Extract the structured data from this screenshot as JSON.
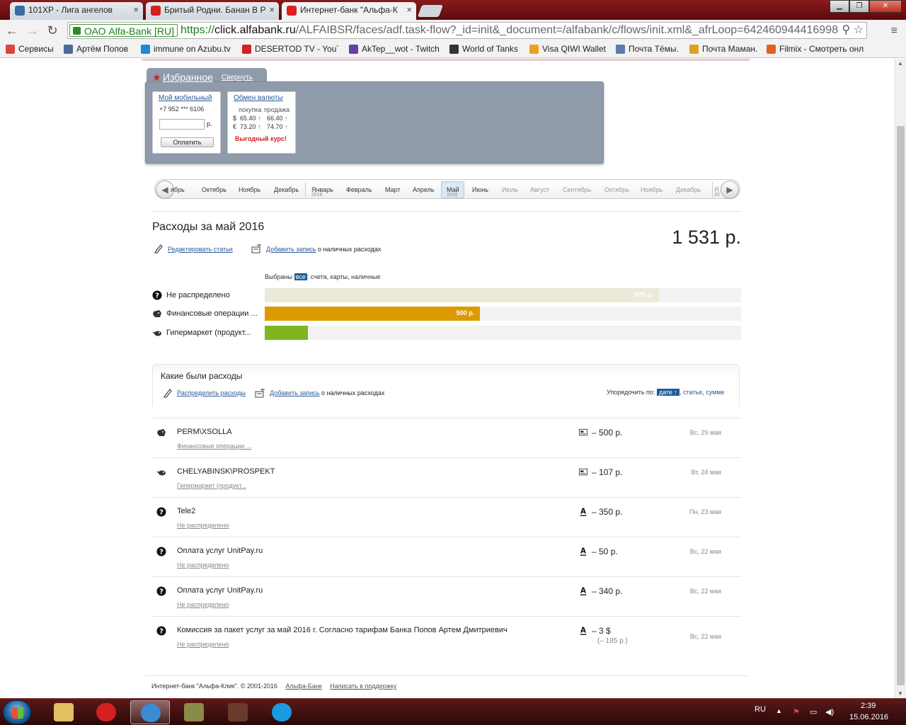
{
  "browser": {
    "tabs": [
      {
        "title": "101XP - Лига ангелов",
        "icon_color": "#3a6aa0"
      },
      {
        "title": "Бритый Родни. Банан В Р",
        "icon_color": "#d42020"
      },
      {
        "title": "Интернет-банк \"Альфа-К",
        "icon_color": "#e02020"
      }
    ],
    "close_glyph": "×",
    "window_buttons": {
      "minimize": "▁",
      "maximize": "❐",
      "close": "✕"
    },
    "nav": {
      "back": "←",
      "forward": "→",
      "reload": "↻"
    },
    "ev_badge": "ОАО Alfa-Bank [RU]",
    "url_scheme": "https://",
    "url_host": "click.alfabank.ru",
    "url_rest": "/ALFAIBSR/faces/adf.task-flow?_id=init&_document=/alfabank/c/flows/init.xml&_afrLoop=642460944416998008",
    "omni_icons": "⚲ ☆",
    "menu_glyph": "≡",
    "bookmarks": [
      {
        "label": "Сервисы",
        "icon_color": "#d44"
      },
      {
        "label": "Артём Попов",
        "icon_color": "#4a6a9a"
      },
      {
        "label": "immune on Azubu.tv",
        "icon_color": "#1a8ad4"
      },
      {
        "label": "DESERTOD TV - YouTu",
        "icon_color": "#d42020"
      },
      {
        "label": "AkTep__wot - Twitch",
        "icon_color": "#6441a4"
      },
      {
        "label": "World of Tanks",
        "icon_color": "#333"
      },
      {
        "label": "Visa QIWI Wallet",
        "icon_color": "#f0a020"
      },
      {
        "label": "Почта Тёмы.",
        "icon_color": "#5a7ab0"
      },
      {
        "label": "Почта Маман.",
        "icon_color": "#e0a020"
      },
      {
        "label": "Filmix - Смотреть онл",
        "icon_color": "#e06020"
      }
    ]
  },
  "favorites": {
    "title": "Избранное",
    "collapse": "Свернуть",
    "mobile": {
      "title": "Мой мобильный",
      "phone": "+7 952 *** 6106",
      "currency": "р.",
      "pay_button": "Оплатить"
    },
    "exchange": {
      "title": "Обмен валюты",
      "col_buy": "покупка",
      "col_sell": "продажа",
      "rates": [
        {
          "symbol": "$",
          "buy": "65.40",
          "sell": "66.40"
        },
        {
          "symbol": "€",
          "buy": "73.20",
          "sell": "74.70"
        }
      ],
      "up_arrow": "↑",
      "good_rate": "Выгодный курс!"
    }
  },
  "months": {
    "prev": "◀",
    "next": "▶",
    "items": [
      {
        "label": "ябрь",
        "year": "",
        "future": false
      },
      {
        "label": "Октябрь",
        "year": "",
        "future": false
      },
      {
        "label": "Ноябрь",
        "year": "",
        "future": false
      },
      {
        "label": "Декабрь",
        "year": "",
        "future": false
      },
      {
        "label": "Январь",
        "year": "2016",
        "future": false
      },
      {
        "label": "Февраль",
        "year": "",
        "future": false
      },
      {
        "label": "Март",
        "year": "",
        "future": false
      },
      {
        "label": "Апрель",
        "year": "",
        "future": false
      },
      {
        "label": "Май",
        "year": "2016",
        "future": false
      },
      {
        "label": "Июнь",
        "year": "",
        "future": false
      },
      {
        "label": "Июль",
        "year": "",
        "future": true
      },
      {
        "label": "Август",
        "year": "",
        "future": true
      },
      {
        "label": "Сентябрь",
        "year": "",
        "future": true
      },
      {
        "label": "Октябрь",
        "year": "",
        "future": true
      },
      {
        "label": "Ноябрь",
        "year": "",
        "future": true
      },
      {
        "label": "Декабрь",
        "year": "",
        "future": true
      },
      {
        "label": "Я",
        "year": "20",
        "future": true
      }
    ]
  },
  "expenses": {
    "title": "Расходы за май 2016",
    "total": "1 531 р.",
    "edit_link": "Редактировать статьи",
    "add_link": "Добавить запись",
    "add_suffix": "о наличных расходах",
    "selected_prefix": "Выбраны",
    "selected_all": "все",
    "selected_suffix": ": счета, карты, наличные",
    "categories": [
      {
        "label": "Не распределено",
        "amount": "925 р.",
        "share": 0.827,
        "color": "#ebe9d8",
        "icon": "question-icon"
      },
      {
        "label": "Финансовые операции ...",
        "amount": "500 р.",
        "share": 0.452,
        "color": "#dd9a00",
        "icon": "piggy-bank-icon"
      },
      {
        "label": "Гипермаркет (продукт...",
        "amount": "",
        "share": 0.09,
        "color": "#7fb521",
        "icon": "basket-icon"
      }
    ]
  },
  "history": {
    "title": "Какие были расходы",
    "distribute_link": "Распределить расходы",
    "add_link": "Добавить запись",
    "add_suffix": "о наличных расходах",
    "sort_label": "Упорядочить по:",
    "sort_active": "дате ↑",
    "sort_comma": ",",
    "sort_by_item": "статье",
    "sort_by_sum": "сумме",
    "transactions": [
      {
        "name": "PERM\\XSOLLA",
        "category": "Финансовые операции ...",
        "amount": "– 500 р.",
        "sub": "",
        "date": "Вс, 29 мая",
        "source": "card",
        "icon": "piggy-bank-icon"
      },
      {
        "name": "CHELYABINSK\\PROSPEKT",
        "category": "Гипермаркет (продукт...",
        "amount": "– 107 р.",
        "sub": "",
        "date": "Вт, 24 мая",
        "source": "card",
        "icon": "basket-icon"
      },
      {
        "name": "Tele2",
        "category": "Не распределено",
        "amount": "– 350 р.",
        "sub": "",
        "date": "Пн, 23 мая",
        "source": "alfa",
        "icon": "question-icon"
      },
      {
        "name": "Оплата услуг UnitPay.ru",
        "category": "Не распределено",
        "amount": "– 50 р.",
        "sub": "",
        "date": "Вс, 22 мая",
        "source": "alfa",
        "icon": "question-icon"
      },
      {
        "name": "Оплата услуг UnitPay.ru",
        "category": "Не распределено",
        "amount": "– 340 р.",
        "sub": "",
        "date": "Вс, 22 мая",
        "source": "alfa",
        "icon": "question-icon"
      },
      {
        "name": "Комиссия за пакет услуг за май 2016 г. Согласно тарифам Банка Попов Артем Дмитриевич",
        "category": "Не распределено",
        "amount": "– 3 $",
        "sub": "(– 185 р.)",
        "date": "Вс, 22 мая",
        "source": "alfa",
        "icon": "question-icon"
      }
    ]
  },
  "footer": {
    "copyright": "Интернет-банк \"Альфа-Клик\". © 2001-2016",
    "link_bank": "Альфа-Банк",
    "link_support": "Написать в поддержку"
  },
  "taskbar": {
    "items": [
      {
        "name": "explorer",
        "color": "#e0c060"
      },
      {
        "name": "opera",
        "color": "#d42020"
      },
      {
        "name": "chrome",
        "color": "#3a8ad4"
      },
      {
        "name": "game",
        "color": "#8a8a4a"
      },
      {
        "name": "game2",
        "color": "#6a3a2a"
      },
      {
        "name": "skype",
        "color": "#1a9ae0"
      }
    ],
    "lang": "RU",
    "tray_up": "▲",
    "tray_flag": "⚑",
    "tray_net": "▭",
    "tray_vol": "◀)",
    "time": "2:39",
    "date": "15.06.2016"
  }
}
